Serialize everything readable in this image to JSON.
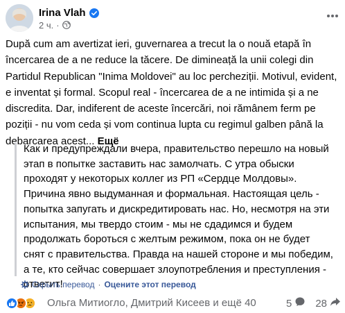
{
  "post": {
    "author": "Irina Vlah",
    "time": "2 ч.",
    "original_text": "După cum am avertizat ieri, guvernarea a trecut la o nouă etapă în încercarea de a ne reduce la tăcere. De dimineață la unii colegi din Partidul Republican \"Inima Moldovei\" au loc percheziții. Motivul, evident, e inventat și formal. Scopul real - încercarea de a ne intimida și a ne discredita. Dar, indiferent de aceste încercări, noi rămânem ferm pe poziții - nu vom ceda și vom continua lupta cu regimul galben până la debarcarea acest...",
    "see_more": "Ещё",
    "translation": "Как и предупреждали вчера, правительство перешло на новый этап в попытке заставить нас замолчать. С утра обыски проходят у некоторых коллег из РП «Сердце Молдовы». Причина явно выдуманная и формальная. Настоящая цель - попытка запугать и дискредитировать нас. Но, несмотря на эти испытания, мы твердо стоим - мы не сдадимся и будем продолжать бороться с желтым режимом, пока он не будет снят с правительства. Правда на нашей стороне и мы победим, а те, кто сейчас совершает злоупотребления и преступления - ответит!",
    "hide_translation": "Скрыть перевод",
    "separator": "·",
    "rate_translation": "Оцените этот перевод"
  },
  "footer": {
    "reactors": "Ольга Митиогло, Дмитрий Кисеев и ещё 40",
    "comments_count": "5",
    "shares_count": "28"
  },
  "icons": {
    "verified": "verified-badge-icon",
    "globe": "globe-icon",
    "more": "more-horizontal-icon",
    "gear": "gear-icon",
    "reactions": [
      "like-icon",
      "angry-icon",
      "sad-icon"
    ],
    "comment": "comment-icon",
    "share": "share-icon"
  },
  "colors": {
    "link": "#385898",
    "secondary": "#65676b",
    "verified": "#1877f2",
    "like": "#1877f2",
    "angry": "#e9710f",
    "sad": "#f7b125"
  }
}
